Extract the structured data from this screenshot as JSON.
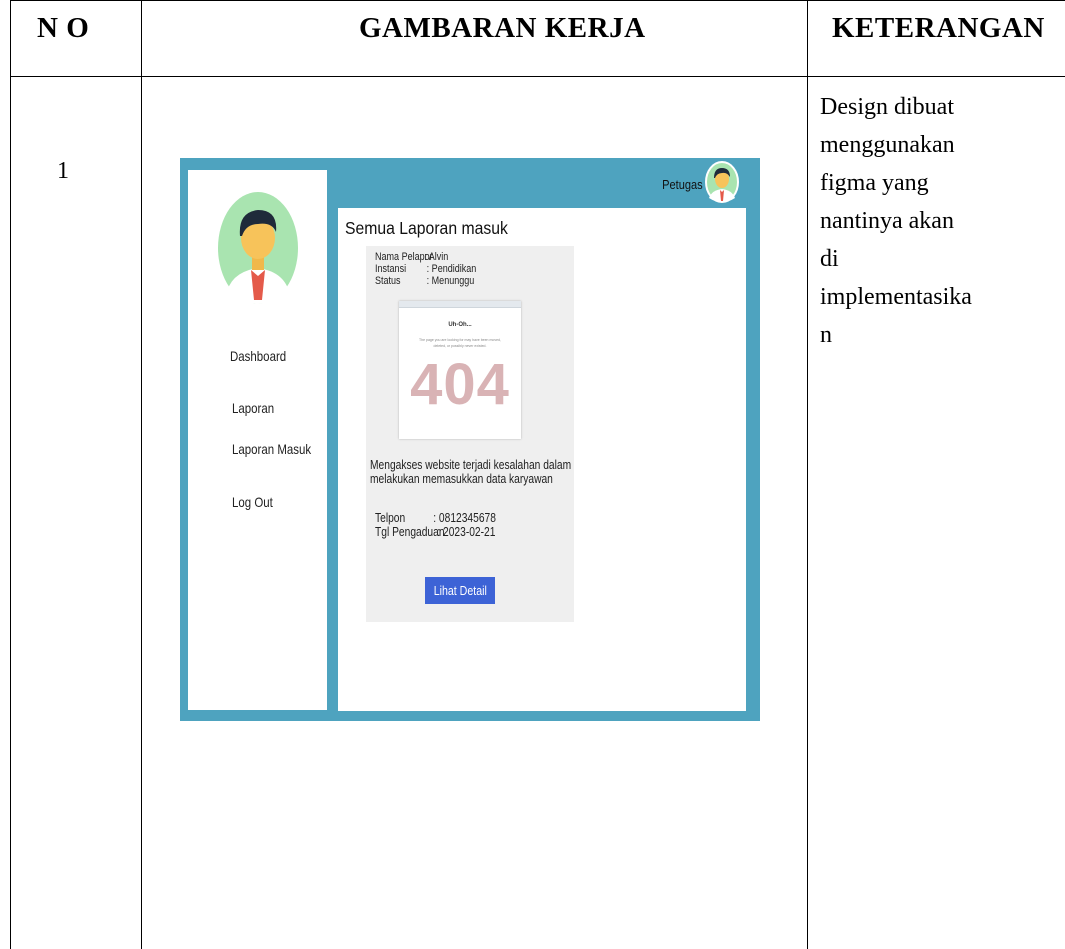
{
  "table": {
    "headers": {
      "no": "N O",
      "gambaran": "GAMBARAN KERJA",
      "keterangan": "KETERANGAN"
    },
    "row": {
      "no": "1",
      "keterangan": "Design dibuat\nmenggunakan\nfigma yang\nnantinya akan\ndi\nimplementasika\nn"
    }
  },
  "mockup": {
    "topbar": {
      "user_label": "Petugas"
    },
    "sidebar": {
      "items": [
        {
          "label": "Dashboard"
        },
        {
          "label": "Laporan"
        },
        {
          "label": "Laporan Masuk"
        },
        {
          "label": "Log Out"
        }
      ]
    },
    "main": {
      "title": "Semua Laporan masuk",
      "card": {
        "nama_key": "Nama Pelapor",
        "nama_val": ": Alvin",
        "instansi_key": "Instansi",
        "instansi_val": ": Pendidikan",
        "status_key": "Status",
        "status_val": ": Menunggu",
        "screenshot": {
          "heading": "Uh-Oh...",
          "message": "The page you are looking for may have been moved, deleted, or possibly never existed.",
          "code": "404"
        },
        "desc_line1": "Mengakses website terjadi kesalahan dalam",
        "desc_line2": "melakukan memasukkan data karyawan",
        "telpon_key": "Telpon",
        "telpon_val": ": 0812345678",
        "tgl_key": "Tgl Pengaduan",
        "tgl_val": ": 2023-02-21",
        "button_label": "Lihat Detail"
      }
    }
  },
  "colors": {
    "frame": "#4ea3bf",
    "button": "#3d63d6",
    "card_bg": "#efefef",
    "avatar_bg": "#a9e4b0",
    "code_text": "#d9b3b5"
  },
  "icons": {
    "profile_large": "person-avatar-icon",
    "profile_small": "person-avatar-icon"
  }
}
